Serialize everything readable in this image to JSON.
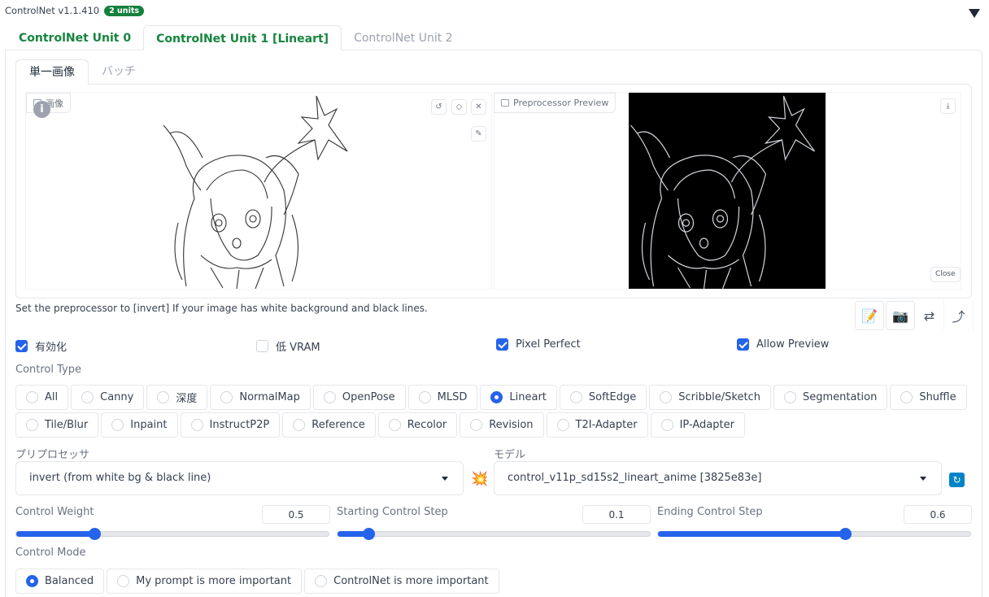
{
  "header": {
    "title": "ControlNet v1.1.410",
    "badge": "2 units"
  },
  "unit_tabs": [
    "ControlNet Unit 0",
    "ControlNet Unit 1 [Lineart]",
    "ControlNet Unit 2"
  ],
  "mode_tabs": [
    "単一画像",
    "バッチ"
  ],
  "image_label": "画像",
  "preview_label": "Preprocessor Preview",
  "close_label": "Close",
  "hint": "Set the preprocessor to [invert] If your image has white background and black lines.",
  "checkboxes": [
    {
      "label": "有効化",
      "checked": true
    },
    {
      "label": "低 VRAM",
      "checked": false
    },
    {
      "label": "Pixel Perfect",
      "checked": true
    },
    {
      "label": "Allow Preview",
      "checked": true
    }
  ],
  "control_type": {
    "label": "Control Type",
    "row1": [
      "All",
      "Canny",
      "深度",
      "NormalMap",
      "OpenPose",
      "MLSD",
      "Lineart",
      "SoftEdge",
      "Scribble/Sketch",
      "Segmentation",
      "Shuffle"
    ],
    "row2": [
      "Tile/Blur",
      "Inpaint",
      "InstructP2P",
      "Reference",
      "Recolor",
      "Revision",
      "T2I-Adapter",
      "IP-Adapter"
    ],
    "selected": "Lineart"
  },
  "preprocessor": {
    "label": "プリプロセッサ",
    "value": "invert (from white bg & black line)"
  },
  "model": {
    "label": "モデル",
    "value": "control_v11p_sd15s2_lineart_anime [3825e83e]"
  },
  "sliders": [
    {
      "label": "Control Weight",
      "value": "0.5",
      "fraction": 0.25
    },
    {
      "label": "Starting Control Step",
      "value": "0.1",
      "fraction": 0.1
    },
    {
      "label": "Ending Control Step",
      "value": "0.6",
      "fraction": 0.6
    }
  ],
  "control_mode": {
    "label": "Control Mode",
    "options": [
      "Balanced",
      "My prompt is more important",
      "ControlNet is more important"
    ],
    "selected": "Balanced"
  },
  "colors": {
    "accent": "#2563eb",
    "tab_green": "#16853e",
    "badge": "#15803d"
  }
}
